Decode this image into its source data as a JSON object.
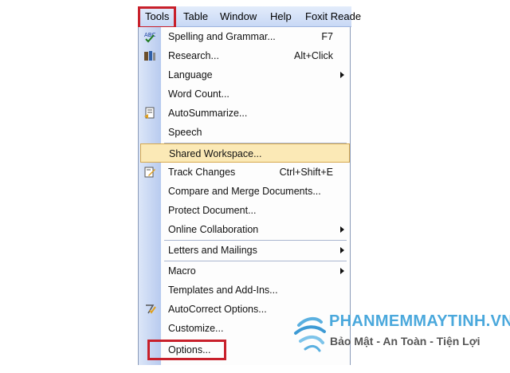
{
  "menubar": {
    "items": [
      {
        "label": "Tools"
      },
      {
        "label": "Table"
      },
      {
        "label": "Window"
      },
      {
        "label": "Help"
      },
      {
        "label": "Foxit Reade"
      }
    ]
  },
  "tools_menu": {
    "items": [
      {
        "label": "Spelling and Grammar...",
        "shortcut": "F7",
        "icon": "spelling-check-icon"
      },
      {
        "label": "Research...",
        "shortcut": "Alt+Click",
        "icon": "research-books-icon"
      },
      {
        "label": "Language",
        "submenu": true
      },
      {
        "label": "Word Count..."
      },
      {
        "label": "AutoSummarize...",
        "icon": "autosummarize-icon"
      },
      {
        "label": "Speech"
      },
      {
        "label": "Shared Workspace...",
        "highlighted": true
      },
      {
        "label": "Track Changes",
        "shortcut": "Ctrl+Shift+E",
        "icon": "track-changes-icon"
      },
      {
        "label": "Compare and Merge Documents..."
      },
      {
        "label": "Protect Document..."
      },
      {
        "label": "Online Collaboration",
        "submenu": true
      },
      {
        "label": "Letters and Mailings",
        "submenu": true
      },
      {
        "label": "Macro",
        "submenu": true
      },
      {
        "label": "Templates and Add-Ins..."
      },
      {
        "label": "AutoCorrect Options...",
        "icon": "autocorrect-icon"
      },
      {
        "label": "Customize..."
      },
      {
        "label": "Options..."
      }
    ]
  },
  "watermark": {
    "title": "PHANMEMMAYTINH.VN",
    "subtitle": "Bảo Mật - An Toàn - Tiện Lợi"
  },
  "colors": {
    "highlight_box": "#c8202b",
    "menu_hover": "#fbe9b6",
    "watermark_blue": "#4aa8dc"
  }
}
